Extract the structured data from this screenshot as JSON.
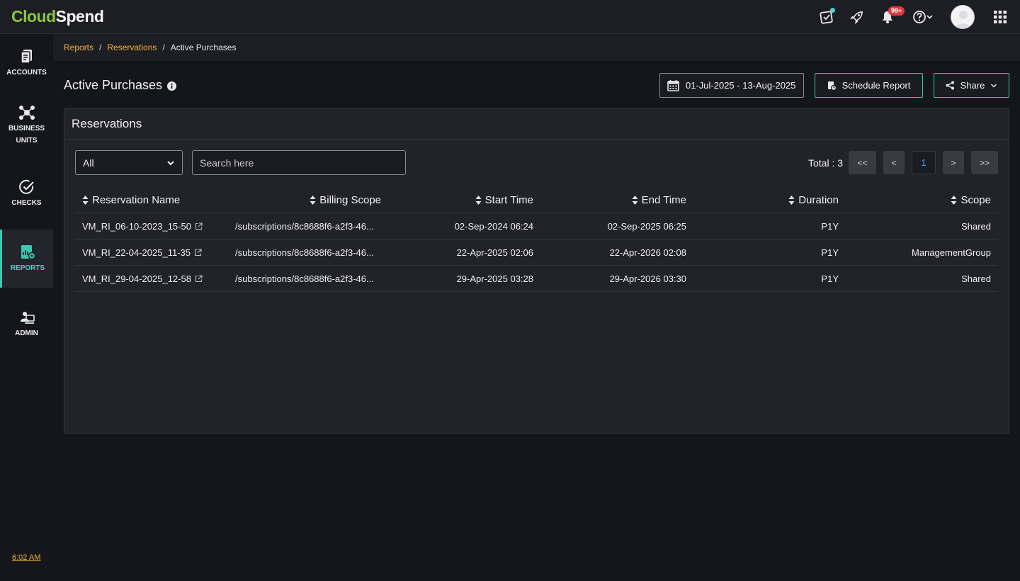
{
  "app": {
    "logo_part1": "Cloud",
    "logo_part2": "Spend"
  },
  "topbar": {
    "notification_count": "99+"
  },
  "sidebar": {
    "items": [
      {
        "label": "ACCOUNTS",
        "icon": "accounts-icon"
      },
      {
        "label_line1": "BUSINESS",
        "label_line2": "UNITS",
        "icon": "business-units-icon"
      },
      {
        "label": "CHECKS",
        "icon": "checks-icon"
      },
      {
        "label": "REPORTS",
        "icon": "reports-icon",
        "active": true
      },
      {
        "label": "ADMIN",
        "icon": "admin-icon"
      }
    ],
    "time": "6:02 AM"
  },
  "breadcrumb": {
    "item1": "Reports",
    "item2": "Reservations",
    "current": "Active Purchases",
    "separator": "/"
  },
  "page": {
    "title": "Active Purchases",
    "date_range": "01-Jul-2025 - 13-Aug-2025",
    "schedule_label": "Schedule Report",
    "share_label": "Share"
  },
  "panel": {
    "title": "Reservations",
    "filter_value": "All",
    "search_placeholder": "Search here",
    "total_label": "Total : 3",
    "pagination": {
      "first": "<<",
      "prev": "<",
      "current": "1",
      "next": ">",
      "last": ">>"
    }
  },
  "table": {
    "headers": [
      "Reservation Name",
      "Billing Scope",
      "Start Time",
      "End Time",
      "Duration",
      "Scope"
    ],
    "rows": [
      [
        "VM_RI_06-10-2023_15-50",
        "/subscriptions/8c8688f6-a2f3-46...",
        "02-Sep-2024 06:24",
        "02-Sep-2025 06:25",
        "P1Y",
        "Shared"
      ],
      [
        "VM_RI_22-04-2025_11-35",
        "/subscriptions/8c8688f6-a2f3-46...",
        "22-Apr-2025 02:06",
        "22-Apr-2026 02:08",
        "P1Y",
        "ManagementGroup"
      ],
      [
        "VM_RI_29-04-2025_12-58",
        "/subscriptions/8c8688f6-a2f3-46...",
        "29-Apr-2025 03:28",
        "29-Apr-2026 03:30",
        "P1Y",
        "Shared"
      ]
    ]
  },
  "colors": {
    "accent": "#3ec6b2",
    "link": "#f0b43a",
    "brand_green": "#8cc63f",
    "badge": "#e0383e"
  }
}
